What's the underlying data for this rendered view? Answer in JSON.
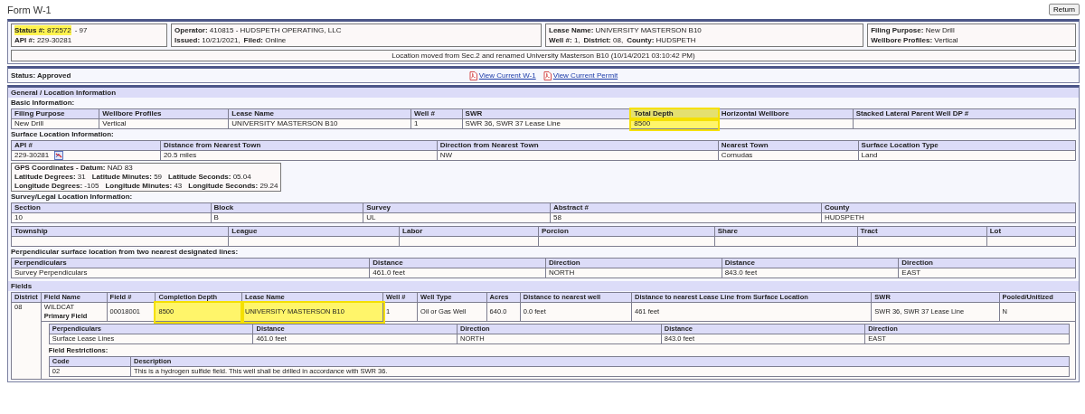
{
  "title": "Form W-1",
  "return_button": "Return",
  "header": {
    "boxes": [
      {
        "lines": [
          [
            {
              "label": "Status #:",
              "value": "872572",
              "highlighted": true
            },
            {
              "value": "- 97"
            }
          ],
          [
            {
              "label": "API #:",
              "value": "229-30281"
            }
          ]
        ]
      },
      {
        "lines": [
          [
            {
              "label": "Operator:",
              "value": "410815 - HUDSPETH OPERATING, LLC"
            }
          ],
          [
            {
              "label": "Issued:",
              "value": "10/21/2021,"
            },
            {
              "label": "Filed:",
              "value": "Online"
            }
          ]
        ]
      },
      {
        "lines": [
          [
            {
              "label": "Lease Name:",
              "value": "UNIVERSITY MASTERSON B10"
            }
          ],
          [
            {
              "label": "Well #:",
              "value": "1,"
            },
            {
              "label": "District:",
              "value": "08,"
            },
            {
              "label": "County:",
              "value": "HUDSPETH"
            }
          ]
        ]
      },
      {
        "lines": [
          [
            {
              "label": "Filing Purpose:",
              "value": "New Drill"
            }
          ],
          [
            {
              "label": "Wellbore Profiles:",
              "value": "Vertical"
            }
          ]
        ]
      }
    ],
    "note": "Location moved from Sec.2 and renamed University Masterson B10 (10/14/2021 03:10:42 PM)"
  },
  "status_bar": {
    "label": "Status:",
    "value": "Approved",
    "links": [
      "View Current W-1",
      "View Current Permit"
    ]
  },
  "general": {
    "title": "General / Location Information",
    "blocks": [
      {
        "kind": "heading",
        "text": "Basic Information:"
      },
      {
        "kind": "table",
        "columns": [
          "Filing Purpose",
          "Wellbore Profiles",
          "Lease Name",
          "Well #",
          "SWR",
          {
            "text": "Total Depth",
            "highlighted": true
          },
          "Horizontal Wellbore",
          "Stacked Lateral Parent Well DP #"
        ],
        "rows": [
          [
            "New Drill",
            "Vertical",
            "UNIVERSITY MASTERSON B10",
            "1",
            "SWR 36, SWR 37 Lease Line",
            {
              "text": "8500",
              "highlighted": true
            },
            null,
            null
          ]
        ]
      },
      {
        "kind": "heading",
        "text": "Surface Location Information:"
      },
      {
        "kind": "table",
        "columns": [
          "API #",
          "Distance from Nearest Town",
          "Direction from Nearest Town",
          "Nearest Town",
          "Surface Location Type"
        ],
        "rows": [
          [
            {
              "text": "229-30281",
              "kind": "map_link"
            },
            "20.5 miles",
            "NW",
            "Cornudas",
            "Land"
          ]
        ]
      },
      {
        "kind": "gps",
        "lines": [
          [
            {
              "label": "GPS Coordinates - Datum:",
              "value": "NAD 83"
            }
          ],
          [
            {
              "label": "Latitude Degrees:",
              "value": "31"
            },
            {
              "label": "Latitude Minutes:",
              "value": "59"
            },
            {
              "label": "Latitude Seconds:",
              "value": "05.04"
            }
          ],
          [
            {
              "label": "Longitude Degrees:",
              "value": "-105"
            },
            {
              "label": "Longitude Minutes:",
              "value": "43"
            },
            {
              "label": "Longitude Seconds:",
              "value": "29.24"
            }
          ]
        ]
      },
      {
        "kind": "heading",
        "text": "Survey/Legal Location Information:"
      },
      {
        "kind": "table",
        "columns": [
          "Section",
          "Block",
          "Survey",
          "Abstract #",
          "County"
        ],
        "rows": [
          [
            "10",
            "B",
            "UL",
            "58",
            "HUDSPETH"
          ]
        ]
      },
      {
        "kind": "table",
        "columns": [
          "Township",
          "League",
          "Labor",
          "Porcion",
          "Share",
          "Tract",
          "Lot"
        ],
        "rows": [
          [
            null,
            null,
            null,
            null,
            null,
            null,
            null
          ]
        ]
      },
      {
        "kind": "heading",
        "text": "Perpendicular surface location from two nearest designated lines:"
      },
      {
        "kind": "table",
        "columns": [
          "Perpendiculars",
          "Distance",
          "Direction",
          "Distance",
          "Direction"
        ],
        "rows": [
          [
            "Survey Perpendiculars",
            "461.0 feet",
            "NORTH",
            "843.0 feet",
            "EAST"
          ]
        ]
      }
    ]
  },
  "fields": {
    "title": "Fields",
    "columns": [
      "District",
      "Field Name",
      "Field #",
      "Completion Depth",
      "Lease Name",
      "Well #",
      "Well Type",
      "Acres",
      "Distance to nearest well",
      "Distance to nearest Lease Line from Surface Location",
      "SWR",
      "Pooled/Unitized"
    ],
    "row": [
      "08",
      {
        "text": "WILDCAT",
        "sub": "Primary Field"
      },
      "00018001",
      {
        "text": "8500",
        "highlighted": true
      },
      {
        "text": "UNIVERSITY MASTERSON B10",
        "highlighted": true
      },
      "1",
      "Oil or Gas Well",
      "640.0",
      "0.0 feet",
      "461 feet",
      "SWR 36, SWR 37 Lease Line",
      "N"
    ],
    "perpendiculars": {
      "columns": [
        "Perpendiculars",
        "Distance",
        "Direction",
        "Distance",
        "Direction"
      ],
      "rows": [
        [
          "Surface Lease Lines",
          "461.0 feet",
          "NORTH",
          "843.0 feet",
          "EAST"
        ]
      ]
    },
    "restrictions": {
      "title": "Field Restrictions:",
      "columns": [
        "Code",
        "Description"
      ],
      "rows": [
        [
          "02",
          "This is a hydrogen sulfide field. This well shall be drilled in accordance with SWR 36."
        ]
      ]
    }
  }
}
